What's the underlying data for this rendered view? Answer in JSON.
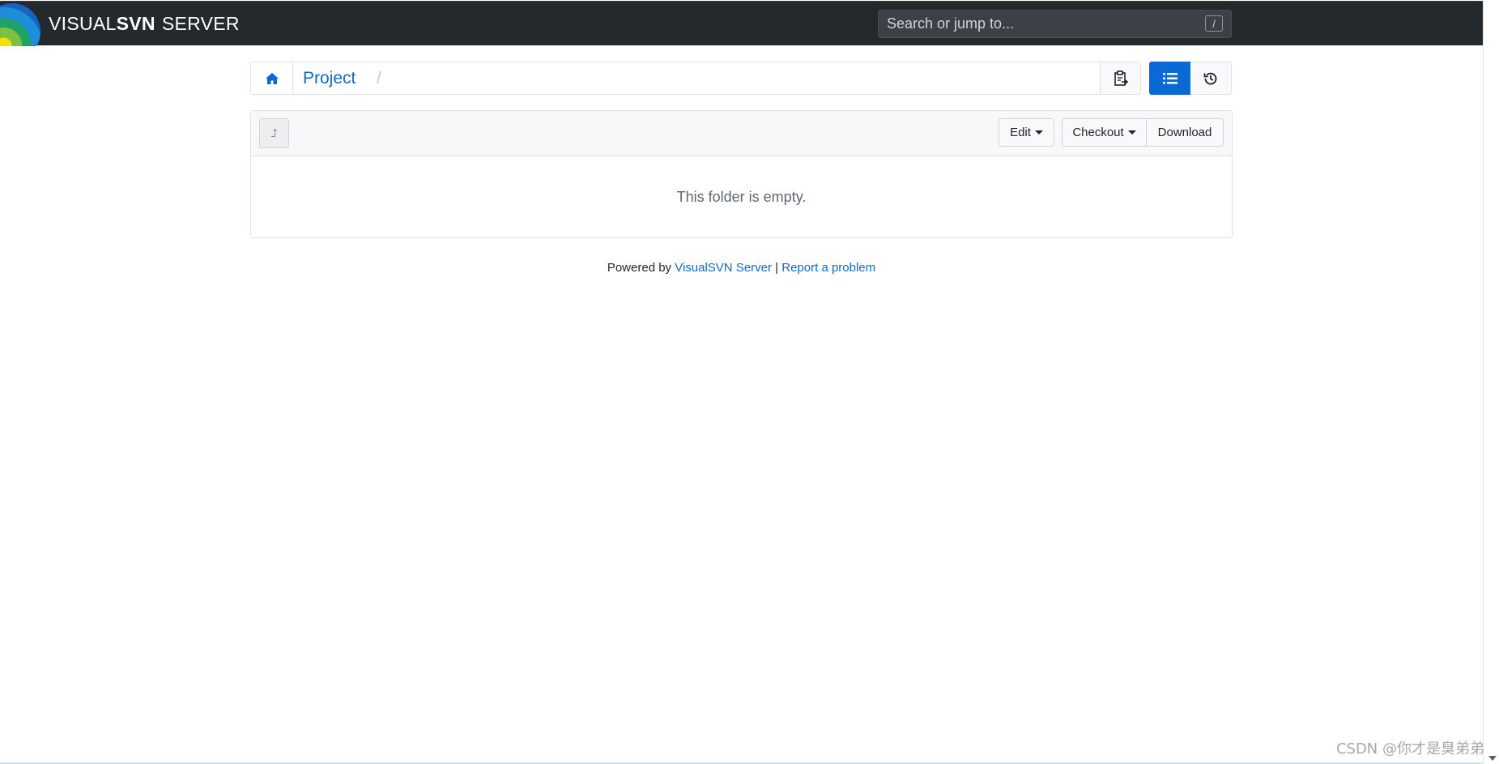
{
  "header": {
    "brand_part1": "VISUAL",
    "brand_part2": "SVN",
    "brand_part3": "SERVER",
    "search_placeholder": "Search or jump to...",
    "search_shortcut": "/"
  },
  "breadcrumb": {
    "home_icon": "home-icon",
    "project": "Project",
    "separator": "/"
  },
  "view_buttons": {
    "copy_icon": "clipboard-icon",
    "list_icon": "list-icon",
    "history_icon": "history-icon"
  },
  "toolbar": {
    "up_icon": "level-up-icon",
    "up_glyph": "⮥",
    "edit_label": "Edit",
    "checkout_label": "Checkout",
    "download_label": "Download"
  },
  "folder": {
    "empty_message": "This folder is empty."
  },
  "footer": {
    "powered_by": "Powered by",
    "product_link": "VisualSVN Server",
    "divider": "|",
    "report_link": "Report a problem"
  },
  "watermark": "CSDN @你才是臭弟弟",
  "colors": {
    "navbar": "#24292e",
    "accent": "#0b69d6",
    "link": "#0d6bc7"
  }
}
